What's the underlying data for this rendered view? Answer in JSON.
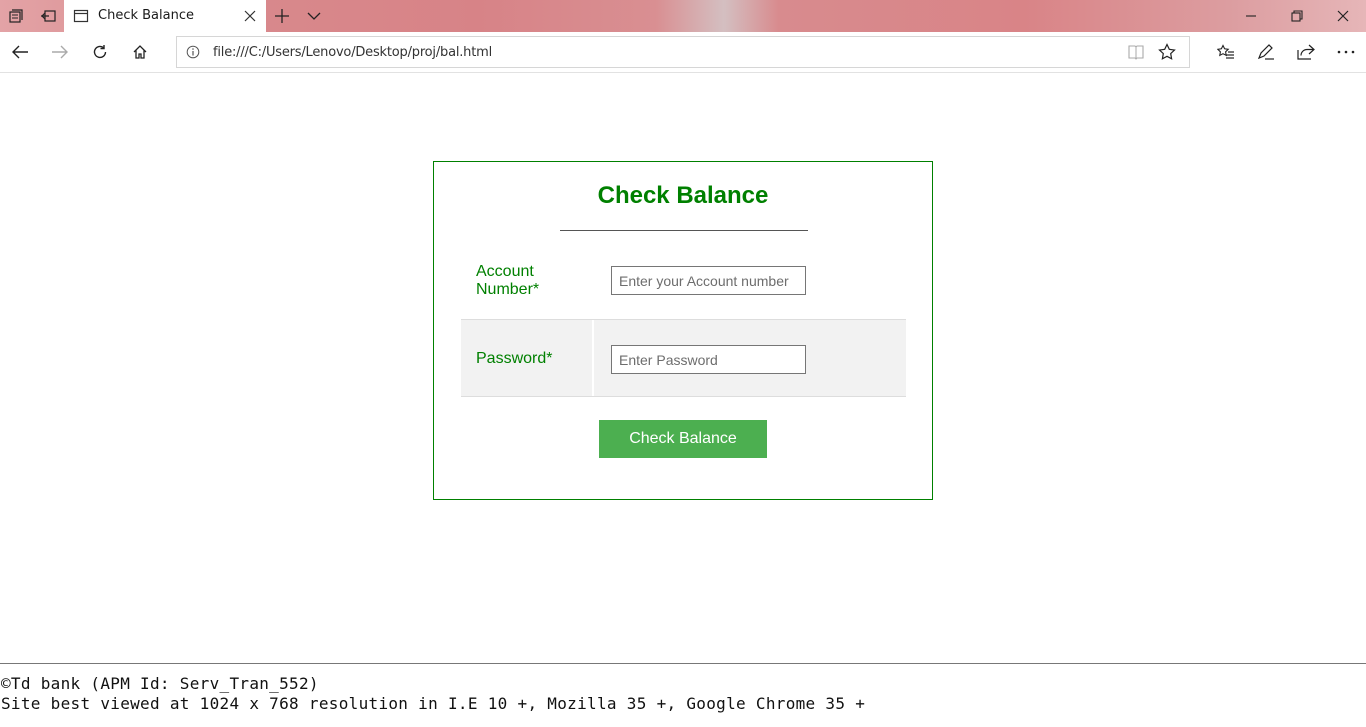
{
  "browser": {
    "tab_title": "Check Balance",
    "url": "file:///C:/Users/Lenovo/Desktop/proj/bal.html"
  },
  "form": {
    "heading": "Check Balance",
    "account_label": "Account Number*",
    "account_placeholder": "Enter your Account number",
    "account_value": "",
    "password_label": "Password*",
    "password_placeholder": "Enter Password",
    "password_value": "",
    "submit_label": "Check Balance"
  },
  "footer": {
    "copyright": "©Td bank (APM Id: Serv_Tran_552)",
    "compat_note": "Site best viewed at 1024 x 768 resolution in I.E 10 +, Mozilla 35 +, Google Chrome 35 +"
  },
  "colors": {
    "accent_green": "#008000",
    "button_green": "#4caf50"
  },
  "icons": [
    "tab-manager-icon",
    "set-aside-tabs-icon",
    "page-icon",
    "close-icon",
    "new-tab-icon",
    "tab-list-chevron-icon",
    "minimize-icon",
    "restore-icon",
    "window-close-icon",
    "back-icon",
    "forward-icon",
    "refresh-icon",
    "home-icon",
    "info-icon",
    "reading-view-icon",
    "favorite-star-icon",
    "favorites-hub-icon",
    "pen-icon",
    "share-icon",
    "more-icon"
  ]
}
